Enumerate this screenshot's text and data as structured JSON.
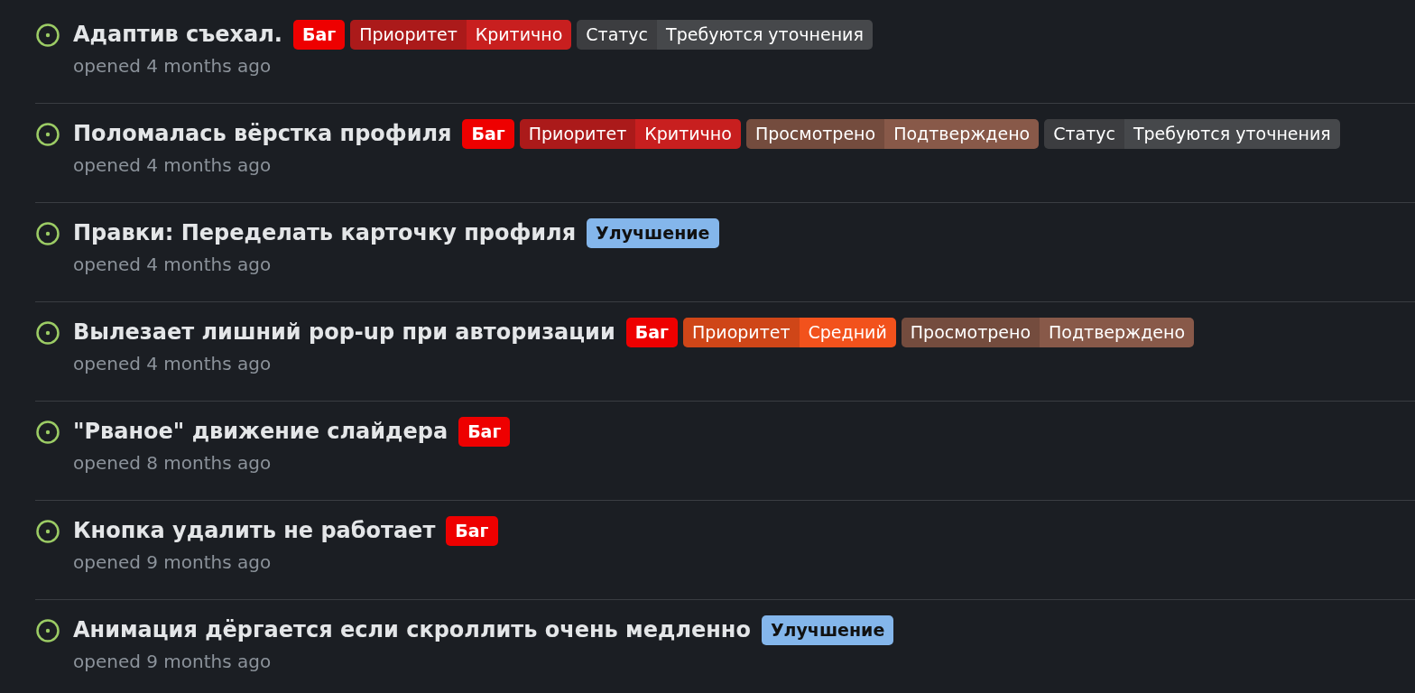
{
  "issues": [
    {
      "title": "Адаптив съехал.",
      "meta": "opened 4 months ago",
      "labels": [
        {
          "kind": "simple",
          "text": "Баг",
          "color": "#ee0000"
        },
        {
          "kind": "scoped",
          "key": "Приоритет",
          "value": "Критично",
          "color": "#c81f1f"
        },
        {
          "kind": "scoped",
          "key": "Статус",
          "value": "Требуются уточнения",
          "color": "#46484b"
        }
      ]
    },
    {
      "title": "Поломалась вёрстка профиля",
      "meta": "opened 4 months ago",
      "labels": [
        {
          "kind": "simple",
          "text": "Баг",
          "color": "#ee0000"
        },
        {
          "kind": "scoped",
          "key": "Приоритет",
          "value": "Критично",
          "color": "#c81f1f"
        },
        {
          "kind": "scoped",
          "key": "Просмотрено",
          "value": "Подтверждено",
          "color": "#885949"
        },
        {
          "kind": "scoped",
          "key": "Статус",
          "value": "Требуются уточнения",
          "color": "#46484b"
        }
      ]
    },
    {
      "title": "Правки: Переделать карточку профиля",
      "meta": "opened 4 months ago",
      "labels": [
        {
          "kind": "simple",
          "text": "Улучшение",
          "color": "#84b6eb"
        }
      ]
    },
    {
      "title": "Вылезает лишний pop-up при авторизации",
      "meta": "opened 4 months ago",
      "labels": [
        {
          "kind": "simple",
          "text": "Баг",
          "color": "#ee0000"
        },
        {
          "kind": "scoped",
          "key": "Приоритет",
          "value": "Средний",
          "color": "#f2521c"
        },
        {
          "kind": "scoped",
          "key": "Просмотрено",
          "value": "Подтверждено",
          "color": "#885949"
        }
      ]
    },
    {
      "title": "\"Рваное\" движение слайдера",
      "meta": "opened 8 months ago",
      "labels": [
        {
          "kind": "simple",
          "text": "Баг",
          "color": "#ee0000"
        }
      ]
    },
    {
      "title": "Кнопка удалить не работает",
      "meta": "opened 9 months ago",
      "labels": [
        {
          "kind": "simple",
          "text": "Баг",
          "color": "#ee0000"
        }
      ]
    },
    {
      "title": "Анимация дёргается если скроллить очень медленно",
      "meta": "opened 9 months ago",
      "labels": [
        {
          "kind": "simple",
          "text": "Улучшение",
          "color": "#84b6eb"
        }
      ]
    }
  ]
}
